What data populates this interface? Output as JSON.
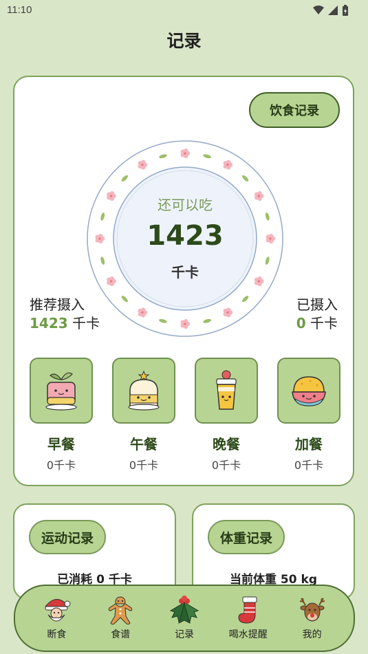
{
  "status": {
    "time": "11:10"
  },
  "page": {
    "title": "记录"
  },
  "main": {
    "diet_button": "饮食记录",
    "plate": {
      "label": "还可以吃",
      "value": "1423",
      "unit": "千卡"
    },
    "recommend": {
      "label": "推荐摄入",
      "value": "1423",
      "unit": " 千卡"
    },
    "consumed": {
      "label": "已摄入",
      "value": "0",
      "unit": " 千卡"
    },
    "meals": [
      {
        "name": "早餐",
        "cal": "0千卡",
        "icon": "breakfast-cup-icon"
      },
      {
        "name": "午餐",
        "cal": "0千卡",
        "icon": "lunch-cake-icon"
      },
      {
        "name": "晚餐",
        "cal": "0千卡",
        "icon": "dinner-drink-icon"
      },
      {
        "name": "加餐",
        "cal": "0千卡",
        "icon": "snack-bowl-icon"
      }
    ]
  },
  "sport": {
    "button": "运动记录",
    "info": "已消耗 0 千卡"
  },
  "weight": {
    "button": "体重记录",
    "info": "当前体重 50 kg"
  },
  "nav": [
    {
      "label": "断食",
      "icon": "santa-icon"
    },
    {
      "label": "食谱",
      "icon": "gingerbread-icon"
    },
    {
      "label": "记录",
      "icon": "holly-icon"
    },
    {
      "label": "喝水提醒",
      "icon": "stocking-icon"
    },
    {
      "label": "我的",
      "icon": "reindeer-icon"
    }
  ],
  "colors": {
    "background": "#dae6c8",
    "accent": "#b8d493",
    "border": "#7da35b",
    "text_green": "#2d4a1a"
  }
}
